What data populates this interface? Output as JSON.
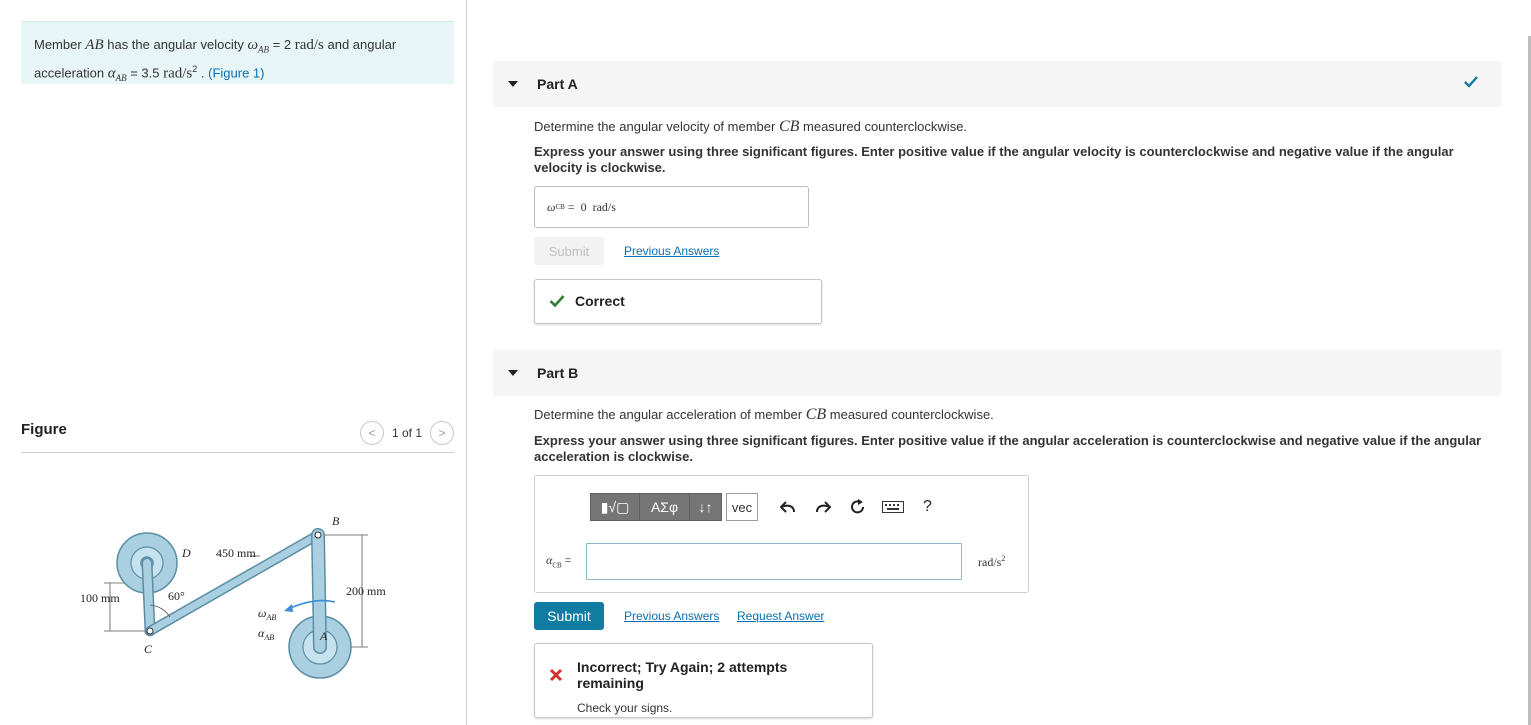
{
  "intro": {
    "t1": "Member ",
    "member": "AB",
    "t2": " has the angular velocity ",
    "omega_sym": "ω",
    "omega_sub": "AB",
    "t3": " = 2 ",
    "omega_unit": "rad/s",
    "t4": " and angular acceleration ",
    "alpha_sym": "α",
    "alpha_sub": "AB",
    "t5": " = 3.5 ",
    "alpha_unit": "rad/s",
    "alpha_unit_exp": "2",
    "t6": " . ",
    "figure_link": "(Figure 1)"
  },
  "figure": {
    "title": "Figure",
    "pager": "1 of 1",
    "prev": "<",
    "next": ">",
    "labels": {
      "B": "B",
      "D": "D",
      "C": "C",
      "A": "A",
      "len_450": "450 mm",
      "len_200": "200 mm",
      "len_100": "100 mm",
      "angle": "60°",
      "omega": "ω",
      "omega_sub": "AB",
      "alpha": "α",
      "alpha_sub": "AB"
    }
  },
  "partA": {
    "title": "Part A",
    "question_pre": "Determine the angular velocity of member ",
    "question_member": "CB",
    "question_post": " measured counterclockwise.",
    "instructions": "Express your answer using three significant figures. Enter positive value if the angular velocity is counterclockwise and negative value if the angular velocity is clockwise.",
    "answer_sym": "ω",
    "answer_sub": "CB",
    "answer_text": " =  0  rad/s",
    "submit_label": "Submit",
    "previous_answers": "Previous Answers",
    "feedback": "Correct"
  },
  "partB": {
    "title": "Part B",
    "question_pre": "Determine the angular acceleration of member ",
    "question_member": "CB",
    "question_post": " measured counterclockwise.",
    "instructions": "Express your answer using three significant figures. Enter positive value if the angular acceleration is counterclockwise and negative value if the angular acceleration is clockwise.",
    "toolbar": {
      "templates": "▮√▢",
      "greek": "ΑΣφ",
      "arrows": "↓↑",
      "vec": "vec",
      "help": "?"
    },
    "input_sym": "α",
    "input_sub": "CB",
    "input_eq": " =",
    "input_value": "",
    "unit": "rad/s",
    "unit_exp": "2",
    "submit_label": "Submit",
    "previous_answers": "Previous Answers",
    "request_answer": "Request Answer",
    "feedback_title": "Incorrect; Try Again; 2 attempts remaining",
    "feedback_sub": "Check your signs."
  },
  "colors": {
    "intro_bg": "#e8f5f7",
    "link": "#0b6fb3",
    "submit": "#107ca2",
    "correct": "#2e7d32",
    "incorrect": "#d32f2f",
    "linkage": "#a9cfe0",
    "linkage_stroke": "#5b8ea6"
  }
}
